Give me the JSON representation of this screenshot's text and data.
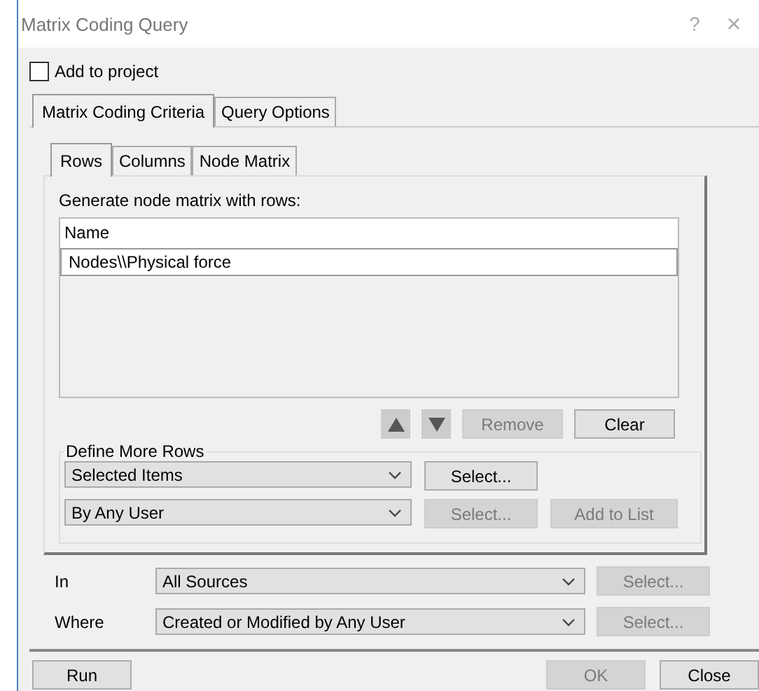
{
  "window": {
    "title": "Matrix Coding Query",
    "help": "?",
    "close": "×"
  },
  "add_to_project": {
    "label": "Add to project",
    "checked": false
  },
  "tabs": [
    {
      "label": "Matrix Coding Criteria",
      "selected": true
    },
    {
      "label": "Query Options",
      "selected": false
    }
  ],
  "sub_tabs": [
    {
      "label": "Rows",
      "selected": true
    },
    {
      "label": "Columns",
      "selected": false
    },
    {
      "label": "Node Matrix",
      "selected": false
    }
  ],
  "rows_label": "Generate node matrix with rows:",
  "rows_list": {
    "header": "Name",
    "items": [
      {
        "label": "Nodes\\\\Physical force",
        "selected": true
      }
    ]
  },
  "list_buttons": [
    {
      "kind": "up",
      "disabled": false
    },
    {
      "kind": "down",
      "disabled": false
    },
    {
      "kind": "text",
      "label": "Remove",
      "disabled": true
    },
    {
      "kind": "text",
      "label": "Clear",
      "disabled": false
    }
  ],
  "define_more_rows": {
    "title": "Define More Rows",
    "rows": [
      {
        "dropdown": "Selected Items",
        "buttons": [
          {
            "label": "Select...",
            "disabled": false
          }
        ]
      },
      {
        "dropdown": "By Any User",
        "buttons": [
          {
            "label": "Select...",
            "disabled": true
          },
          {
            "label": "Add to List",
            "disabled": true
          }
        ]
      }
    ]
  },
  "filters": [
    {
      "label": "In",
      "dropdown": "All Sources",
      "button": {
        "label": "Select...",
        "disabled": true
      }
    },
    {
      "label": "Where",
      "dropdown": "Created or Modified by Any User",
      "button": {
        "label": "Select...",
        "disabled": true
      }
    }
  ],
  "footer": [
    {
      "label": "Run",
      "disabled": false
    },
    {
      "label": "OK",
      "disabled": true
    },
    {
      "label": "Close",
      "disabled": false
    }
  ]
}
